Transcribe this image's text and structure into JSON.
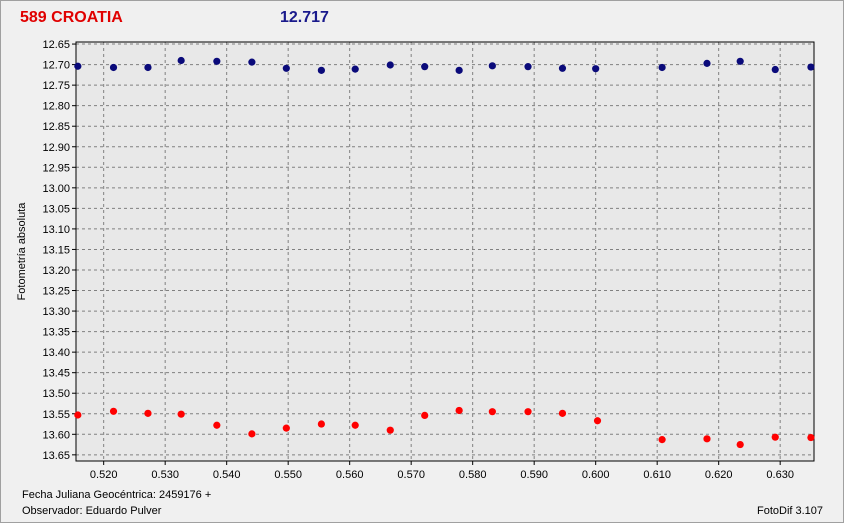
{
  "header": {
    "object": "589 CROATIA",
    "value": "12.717"
  },
  "footer": {
    "jd_label": "Fecha Juliana Geocéntrica: 2459176 +",
    "observer": "Observador: Eduardo Pulver",
    "software": "FotoDif 3.107"
  },
  "colors": {
    "series_blue": "#0a0a7a",
    "series_red": "#ff0000",
    "plot_bg": "#e8e8e8"
  },
  "chart_data": {
    "type": "scatter",
    "ylabel": "Fotometría absoluta",
    "xlabel": "",
    "xlim": [
      0.5155,
      0.6355
    ],
    "ylim": [
      13.665,
      12.645
    ],
    "y_inverted": true,
    "grid": true,
    "xticks": [
      "0.520",
      "0.530",
      "0.540",
      "0.550",
      "0.560",
      "0.570",
      "0.580",
      "0.590",
      "0.600",
      "0.610",
      "0.620",
      "0.630"
    ],
    "yticks": [
      "12.65",
      "12.70",
      "12.75",
      "12.80",
      "12.85",
      "12.90",
      "12.95",
      "13.00",
      "13.05",
      "13.10",
      "13.15",
      "13.20",
      "13.25",
      "13.30",
      "13.35",
      "13.40",
      "13.45",
      "13.50",
      "13.55",
      "13.60",
      "13.65"
    ],
    "series": [
      {
        "color": "#0a0a7a",
        "x": [
          0.5158,
          0.5216,
          0.5272,
          0.5326,
          0.5384,
          0.5441,
          0.5497,
          0.5554,
          0.5609,
          0.5666,
          0.5722,
          0.5778,
          0.5832,
          0.589,
          0.5946,
          0.6,
          0.6108,
          0.6181,
          0.6235,
          0.6292,
          0.635
        ],
        "y": [
          12.704,
          12.707,
          12.707,
          12.69,
          12.692,
          12.694,
          12.709,
          12.714,
          12.711,
          12.701,
          12.705,
          12.714,
          12.703,
          12.705,
          12.709,
          12.71,
          12.707,
          12.697,
          12.692,
          12.712,
          12.706
        ]
      },
      {
        "color": "#ff0000",
        "x": [
          0.5158,
          0.5216,
          0.5272,
          0.5326,
          0.5384,
          0.5441,
          0.5497,
          0.5554,
          0.5609,
          0.5666,
          0.5722,
          0.5778,
          0.5832,
          0.589,
          0.5946,
          0.6003,
          0.6108,
          0.6181,
          0.6235,
          0.6292,
          0.635
        ],
        "y": [
          13.553,
          13.544,
          13.549,
          13.551,
          13.578,
          13.599,
          13.585,
          13.575,
          13.578,
          13.59,
          13.554,
          13.542,
          13.545,
          13.545,
          13.549,
          13.567,
          13.613,
          13.611,
          13.625,
          13.607,
          13.608
        ]
      }
    ]
  }
}
